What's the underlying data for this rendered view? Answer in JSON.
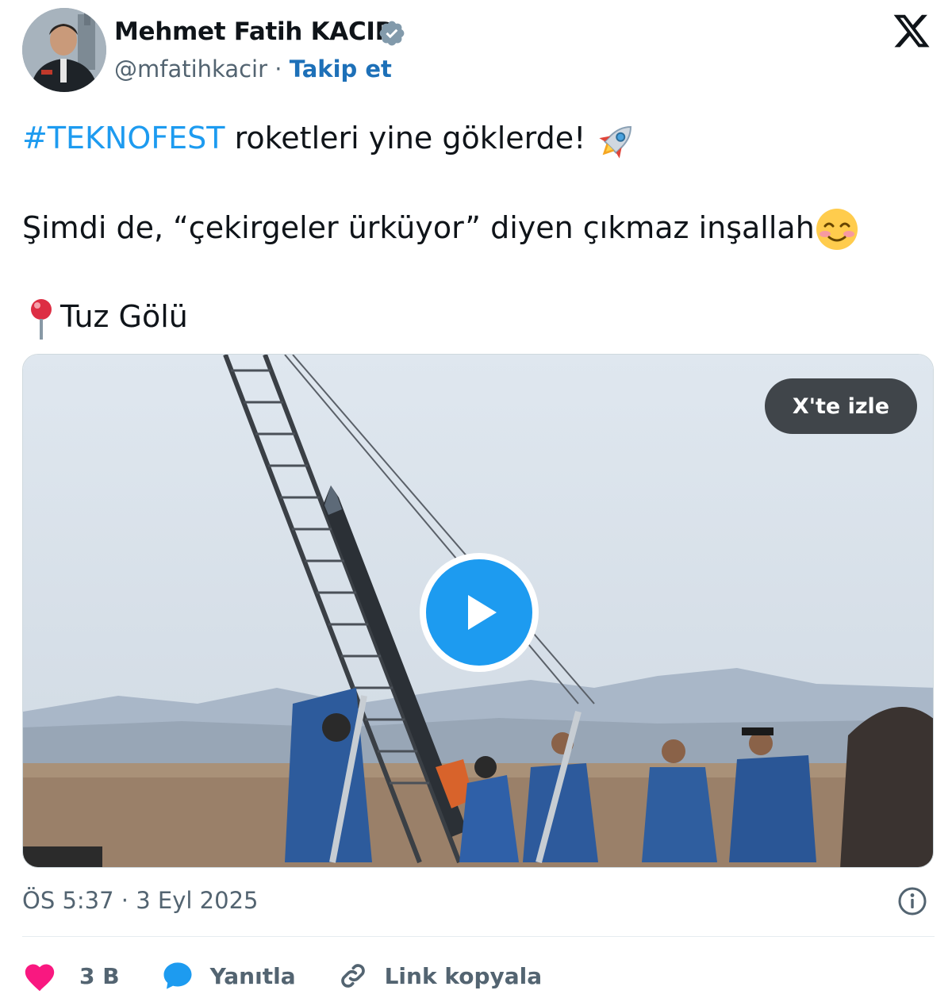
{
  "author": {
    "name": "Mehmet Fatih KACIR",
    "handle": "@mfatihkacir",
    "separator": "·",
    "follow_label": "Takip et"
  },
  "tweet": {
    "hashtag": "#TEKNOFEST",
    "line1_rest": " roketleri yine göklerde! ",
    "line2": "Şimdi de, “çekirgeler ürküyor” diyen çıkmaz inşallah",
    "line3": "Tuz Gölü"
  },
  "media": {
    "watch_label": "X'te izle"
  },
  "meta": {
    "time": "ÖS 5:37",
    "separator": " · ",
    "date": "3 Eyl 2025"
  },
  "actions": {
    "like_count": "3 B",
    "reply_label": "Yanıtla",
    "copy_link_label": "Link kopyala"
  },
  "colors": {
    "accent": "#1d9bf0",
    "like": "#f91880",
    "text_secondary": "#536471"
  }
}
